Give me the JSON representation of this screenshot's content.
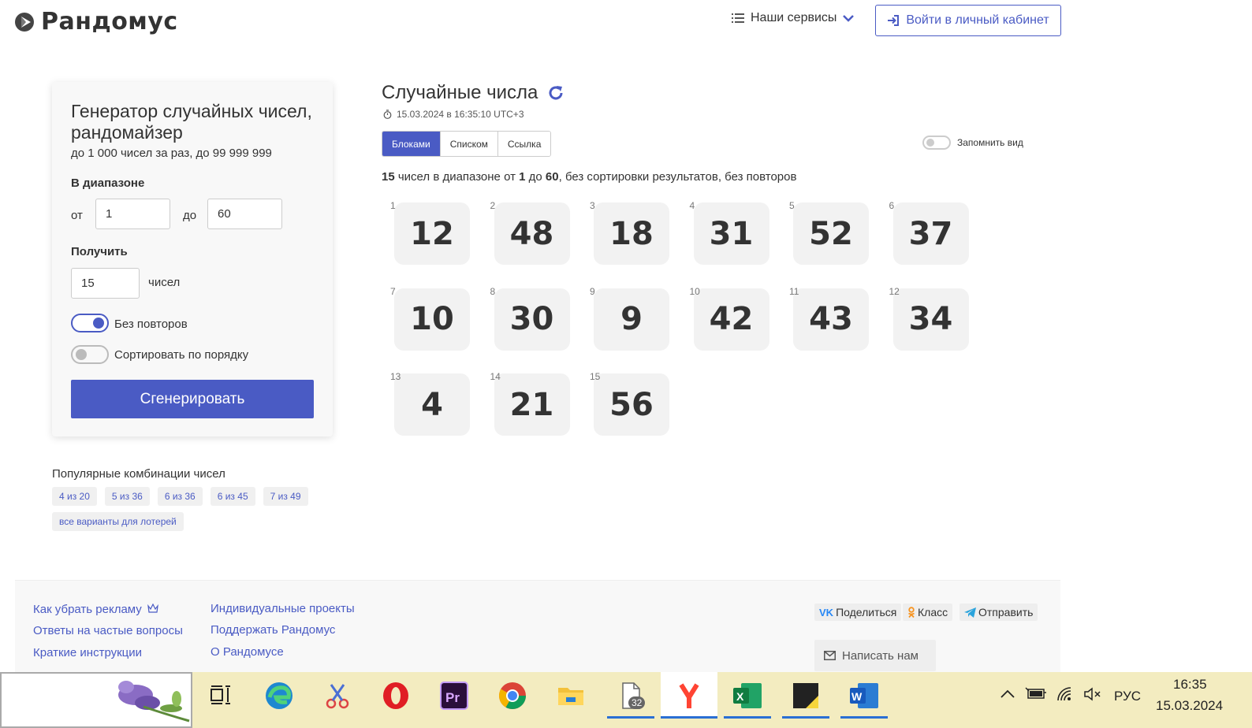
{
  "header": {
    "logo_text": "Рандомус",
    "services_label": "Наши сервисы",
    "login_label": "Войти в личный кабинет"
  },
  "form": {
    "title": "Генератор случайных чисел, рандомайзер",
    "subtitle": "до 1 000 чисел за раз, до 99 999 999",
    "range_label": "В диапазоне",
    "from_label": "от",
    "from_value": "1",
    "to_label": "до",
    "to_value": "60",
    "count_label": "Получить",
    "count_value": "15",
    "count_unit": "чисел",
    "no_repeat_label": "Без повторов",
    "no_repeat_on": true,
    "sort_label": "Сортировать по порядку",
    "sort_on": false,
    "generate_label": "Сгенерировать"
  },
  "popular": {
    "title": "Популярные комбинации чисел",
    "chips": [
      "4 из 20",
      "5 из 36",
      "6 из 36",
      "6 из 45",
      "7 из 49",
      "все варианты для лотерей"
    ]
  },
  "results": {
    "title": "Случайные числа",
    "timestamp": "15.03.2024 в 16:35:10 UTC+3",
    "tabs": [
      {
        "label": "Блоками",
        "active": true
      },
      {
        "label": "Списком",
        "active": false
      },
      {
        "label": "Ссылка",
        "active": false
      }
    ],
    "remember_label": "Запомнить вид",
    "summary": {
      "count": "15",
      "part1": "чисел в диапазоне от",
      "from": "1",
      "part2": "до",
      "to": "60",
      "part3": ", без сортировки результатов, без повторов"
    },
    "numbers": [
      12,
      48,
      18,
      31,
      52,
      37,
      10,
      30,
      9,
      42,
      43,
      34,
      4,
      21,
      56
    ]
  },
  "footer": {
    "col1": [
      "Как убрать рекламу",
      "Ответы на частые вопросы",
      "Краткие инструкции"
    ],
    "col2": [
      "Индивидуальные проекты",
      "Поддержать Рандомус",
      "О Рандомусе"
    ],
    "share": [
      "Поделиться",
      "Класс",
      "Отправить"
    ],
    "write_label": "Написать нам"
  },
  "taskbar": {
    "file_badge": "32",
    "lang": "РУС",
    "time": "16:35",
    "date": "15.03.2024"
  },
  "colors": {
    "accent": "#4a5bc4"
  }
}
